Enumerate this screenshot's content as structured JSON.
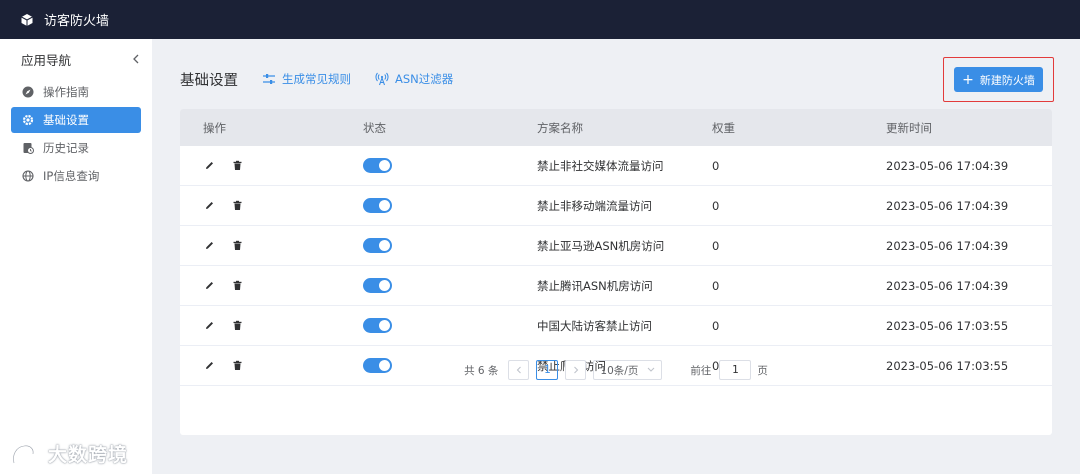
{
  "app": {
    "title": "访客防火墙"
  },
  "sidebar": {
    "header": "应用导航",
    "items": [
      {
        "label": "操作指南",
        "icon": "compass-icon",
        "active": false
      },
      {
        "label": "基础设置",
        "icon": "gear-icon",
        "active": true
      },
      {
        "label": "历史记录",
        "icon": "history-icon",
        "active": false
      },
      {
        "label": "IP信息查询",
        "icon": "globe-icon",
        "active": false
      }
    ]
  },
  "main": {
    "page_title": "基础设置",
    "links": [
      {
        "label": "生成常见规则",
        "icon": "sliders-icon"
      },
      {
        "label": "ASN过滤器",
        "icon": "antenna-icon"
      }
    ],
    "new_button": "新建防火墙"
  },
  "table": {
    "columns": [
      "操作",
      "状态",
      "方案名称",
      "权重",
      "更新时间"
    ],
    "rows": [
      {
        "enabled": true,
        "name": "禁止非社交媒体流量访问",
        "weight": "0",
        "updated": "2023-05-06 17:04:39"
      },
      {
        "enabled": true,
        "name": "禁止非移动端流量访问",
        "weight": "0",
        "updated": "2023-05-06 17:04:39"
      },
      {
        "enabled": true,
        "name": "禁止亚马逊ASN机房访问",
        "weight": "0",
        "updated": "2023-05-06 17:04:39"
      },
      {
        "enabled": true,
        "name": "禁止腾讯ASN机房访问",
        "weight": "0",
        "updated": "2023-05-06 17:04:39"
      },
      {
        "enabled": true,
        "name": "中国大陆访客禁止访问",
        "weight": "0",
        "updated": "2023-05-06 17:03:55"
      },
      {
        "enabled": true,
        "name": "禁止爬虫访问",
        "weight": "0",
        "updated": "2023-05-06 17:03:55"
      }
    ]
  },
  "pagination": {
    "total": "共 6 条",
    "current_page": "1",
    "page_size": "10条/页",
    "goto_label": "前往",
    "goto_value": "1",
    "page_suffix": "页"
  },
  "watermark": {
    "text": "大数跨境"
  },
  "colors": {
    "accent": "#3a8ee6",
    "topbar": "#1b2136",
    "highlight_border": "#e23b3b"
  }
}
